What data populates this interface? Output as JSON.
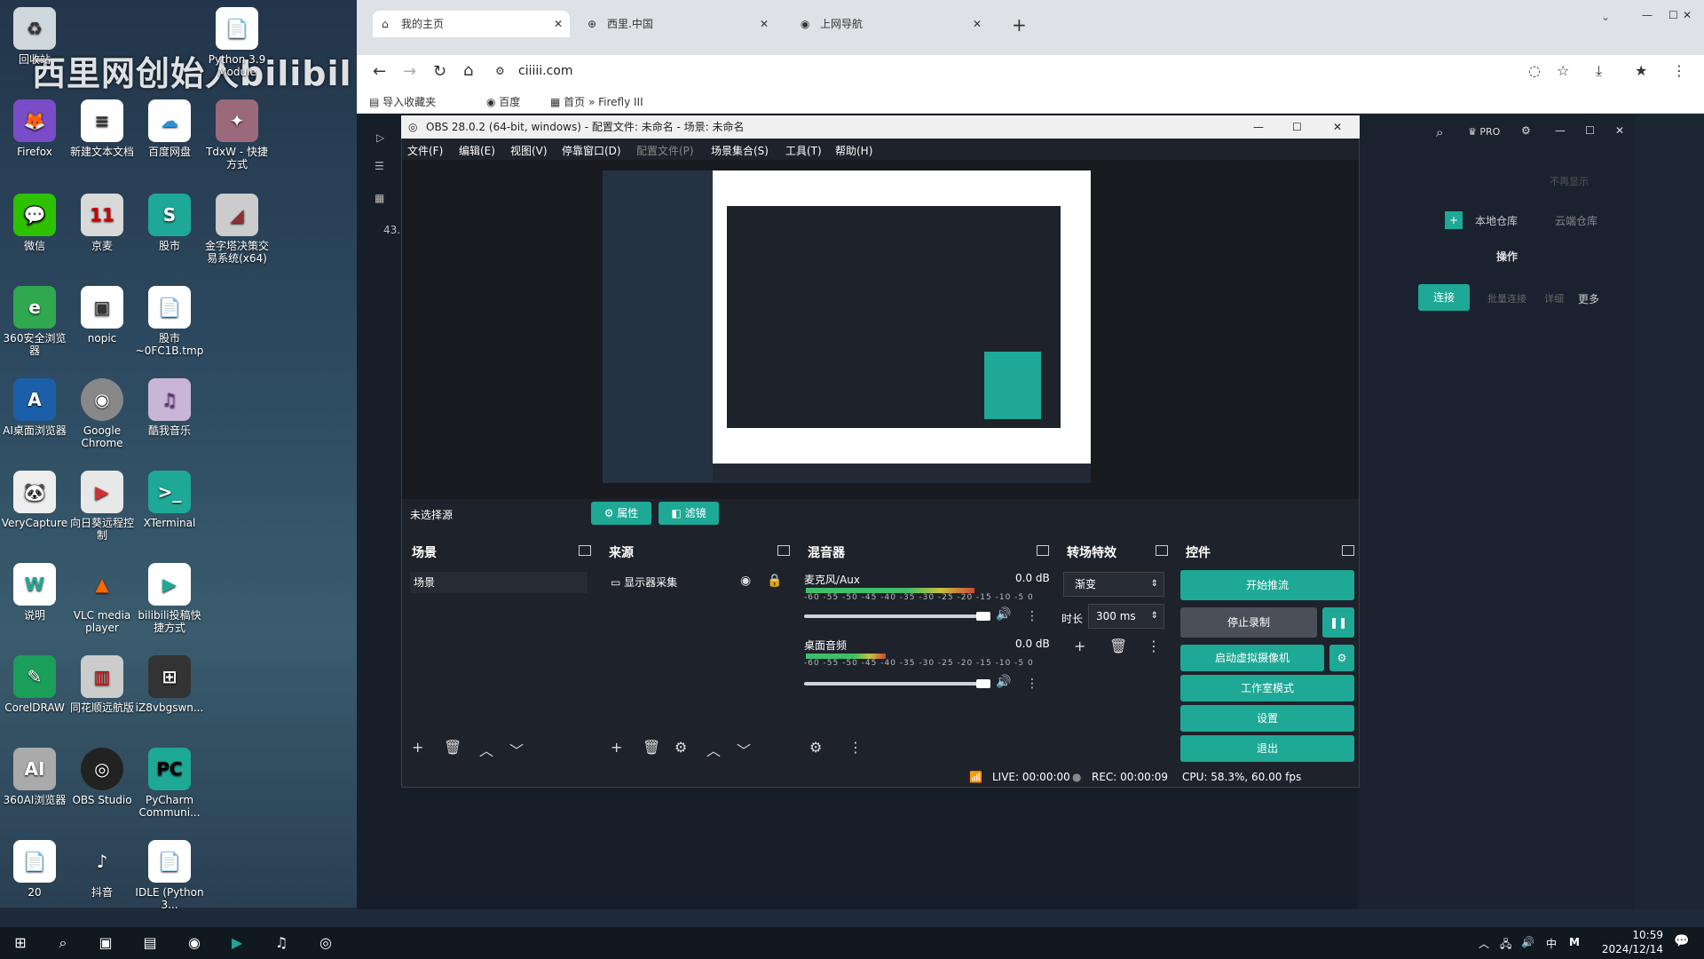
{
  "watermark": "西里网创始人bilibil",
  "desktop": {
    "col1": [
      "Firefox",
      "微信",
      "360安全浏览器",
      "AI桌面浏览器",
      "VeryCapture",
      "说明",
      "CorelDRAW",
      "360AI浏览器",
      "20"
    ],
    "col2": [
      "新建文本文档",
      "京麦",
      "nopic",
      "Google Chrome",
      "向日葵远程控制",
      "VLC media player",
      "同花顺远航版",
      "OBS Studio",
      "抖音"
    ],
    "col3": [
      "百度网盘",
      "股市",
      "股市 ~0FC1B.tmp",
      "酷我音乐",
      "XTerminal",
      "bilibili投稿快捷方式",
      "iZ8vbgswn...",
      "PyCharm Communi...",
      "IDLE (Python 3..."
    ],
    "col4": [
      "TdxW - 快捷方式",
      "金字塔决策交易系统(x64)"
    ],
    "top": [
      "回收站",
      "Python 3.9 Module"
    ]
  },
  "browser": {
    "tabs": [
      "我的主页",
      "西里.中国",
      "上网导航"
    ],
    "url": "ciiiii.com",
    "bookmarks": [
      "导入收藏夹",
      "百度",
      "首页 » Firefly III"
    ],
    "page_num": "43.",
    "right": {
      "hide": "不再显示",
      "local": "本地仓库",
      "cloud": "云端仓库",
      "ops": "操作",
      "connect": "连接",
      "more": "更多",
      "batch": "批量连接",
      "status": "详细"
    }
  },
  "obs": {
    "title": "OBS 28.0.2 (64-bit, windows) - 配置文件: 未命名 - 场景: 未命名",
    "menu": [
      "文件(F)",
      "编辑(E)",
      "视图(V)",
      "停靠窗口(D)",
      "配置文件(P)",
      "场景集合(S)",
      "工具(T)",
      "帮助(H)"
    ],
    "no_source": "未选择源",
    "props_btn": "属性",
    "filter_btn": "滤镜",
    "panels": {
      "scenes": "场景",
      "sources": "来源",
      "mixer": "混音器",
      "transitions": "转场特效",
      "controls": "控件"
    },
    "scene_item": "场景",
    "source_item": "显示器采集",
    "mixer": [
      {
        "name": "麦克风/Aux",
        "db": "0.0 dB"
      },
      {
        "name": "桌面音频",
        "db": "0.0 dB"
      }
    ],
    "scale": "-60 -55 -50 -45 -40 -35 -30 -25 -20 -15 -10 -5 0",
    "transition": {
      "type": "渐变",
      "duration_label": "时长",
      "duration": "300 ms"
    },
    "controls": [
      "开始推流",
      "停止录制",
      "启动虚拟摄像机",
      "工作室模式",
      "设置",
      "退出"
    ],
    "status": {
      "live": "LIVE: 00:00:00",
      "rec": "REC: 00:00:09",
      "cpu": "CPU: 58.3%, 60.00 fps"
    }
  },
  "taskbar": {
    "time": "10:59",
    "date": "2024/12/14",
    "ime": "中",
    "ime2": "M"
  }
}
